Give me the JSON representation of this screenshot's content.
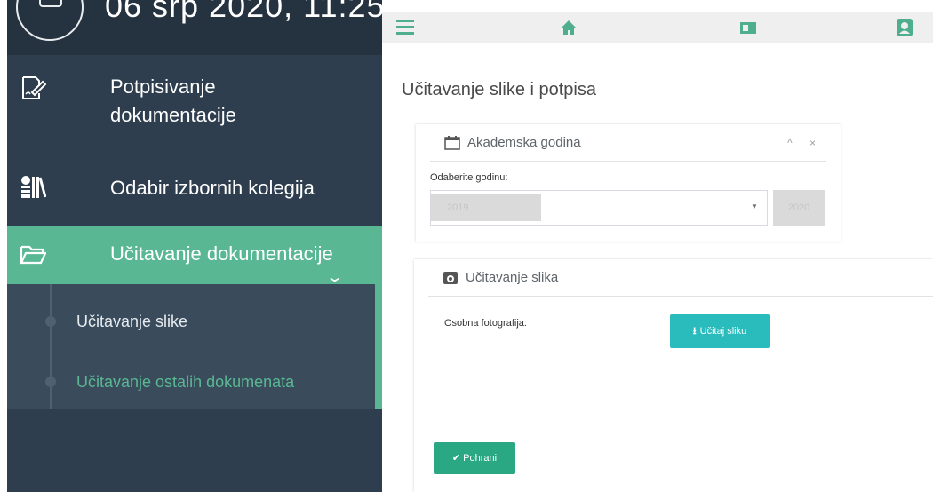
{
  "clock": {
    "text": "06 srp 2020, 11:25"
  },
  "sidebar": {
    "items": [
      {
        "label": "Potpisivanje\ndokumentacije",
        "icon": "document-sign-icon"
      },
      {
        "label": "Odabir izbornih kolegija",
        "icon": "library-icon"
      },
      {
        "label": "Učitavanje dokumentacije",
        "icon": "folder-open-icon",
        "active": true
      }
    ],
    "submenu": [
      {
        "label": "Učitavanje slike"
      },
      {
        "label": "Učitavanje ostalih dokumenata",
        "active": true
      }
    ]
  },
  "topbar": {
    "icons": [
      "menu-icon",
      "home-icon",
      "book-icon",
      "user-icon"
    ]
  },
  "page": {
    "title": "Učitavanje slike i potpisa"
  },
  "academic_year_panel": {
    "title": "Akademska godina",
    "tools": "^ ×",
    "field_label": "Odaberite godinu:",
    "selected_value": "2019",
    "button_label": "2020"
  },
  "upload_panel": {
    "title": "Učitavanje slika",
    "field_label": "Osobna fotografija:",
    "upload_button": "Učitaj sliku",
    "save_button": "Pohrani"
  },
  "colors": {
    "sidebar_bg": "#2e3e4e",
    "accent_green": "#59b893",
    "upload_teal": "#2abcbd",
    "save_green": "#2aa883"
  }
}
